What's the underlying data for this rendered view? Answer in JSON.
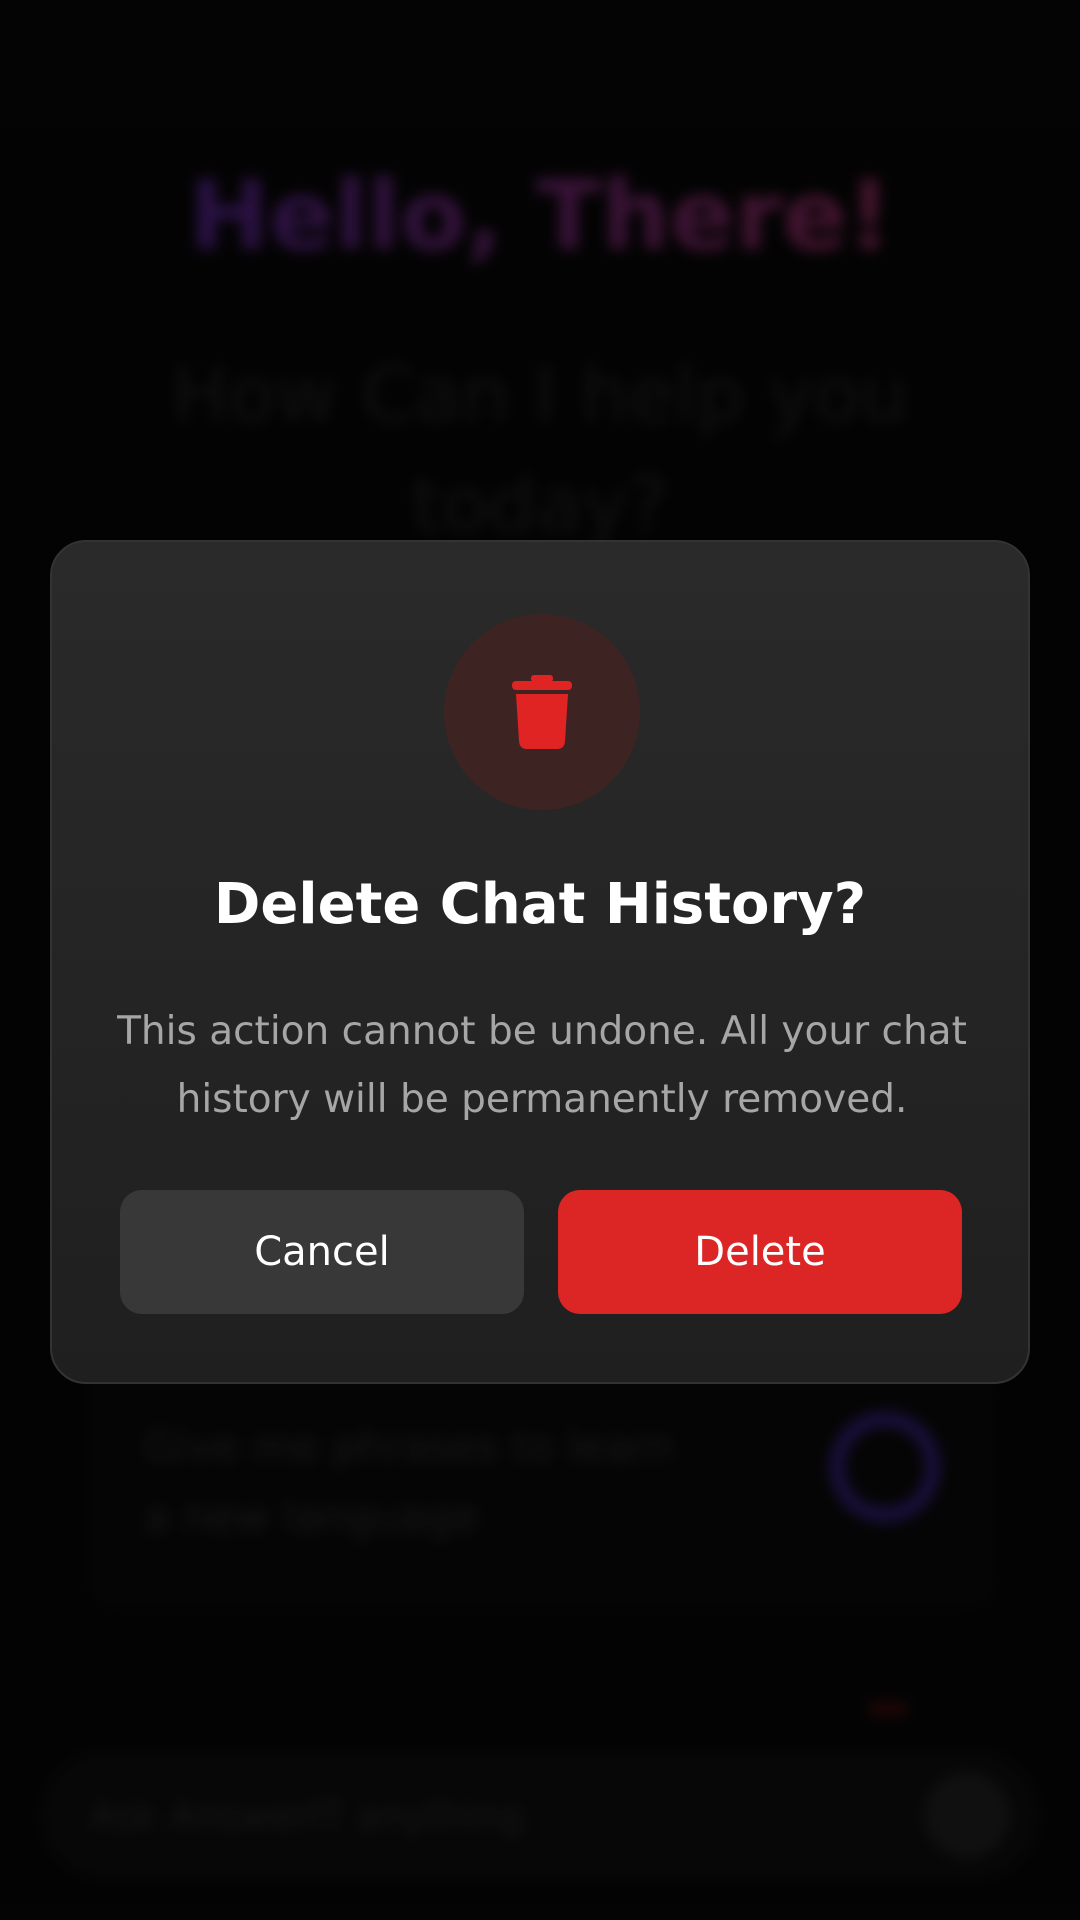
{
  "background": {
    "greeting": "Hello, There!",
    "question": "How Can I help you today?",
    "suggestion_card": {
      "text": "Give me phrases to learn a new language"
    },
    "input": {
      "placeholder": "Ask AnswerIT anything"
    }
  },
  "dialog": {
    "icon": "trash-icon",
    "title": "Delete Chat History?",
    "message": "This action cannot be undone. All your chat history will be permanently removed.",
    "cancel_label": "Cancel",
    "delete_label": "Delete"
  },
  "colors": {
    "accent_danger": "#dc2626",
    "dialog_bg": "#262626",
    "icon_circle_bg": "#3d2423"
  }
}
